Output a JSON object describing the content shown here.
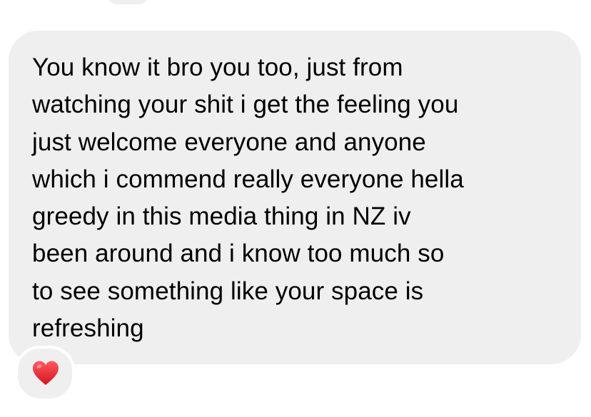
{
  "message": {
    "lines": [
      "You know it bro you too, just from",
      "watching your shit i get the feeling you",
      "just welcome everyone and anyone",
      "which i commend really everyone hella",
      "greedy in this media thing in NZ iv",
      "been around and i know too much so",
      "to see something like your space is",
      "refreshing"
    ]
  },
  "reaction": {
    "icon": "heart-icon",
    "color": "#e8232f"
  },
  "colors": {
    "bubble": "#efefef",
    "text": "#000000",
    "background": "#ffffff"
  }
}
